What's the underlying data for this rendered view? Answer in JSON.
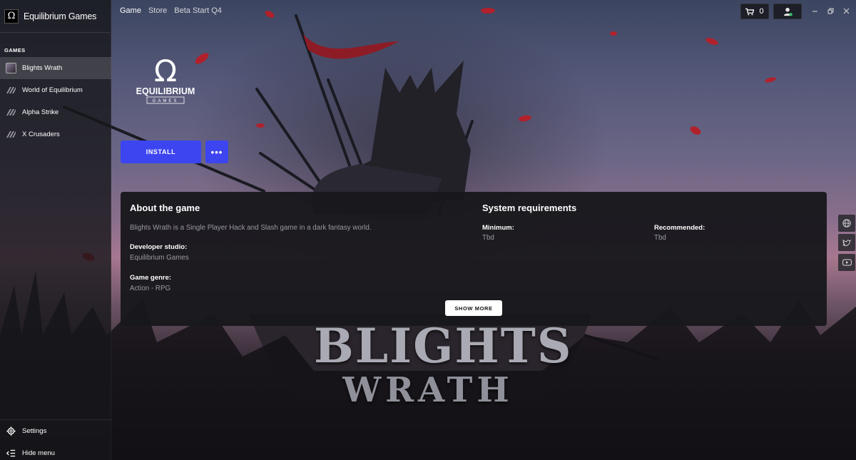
{
  "app": {
    "title": "Equilibrium Games",
    "logo_glyph": "Ω"
  },
  "sidebar": {
    "section_label": "GAMES",
    "items": [
      {
        "label": "Blights Wrath",
        "active": true,
        "icon": "game-cover-thumbnail"
      },
      {
        "label": "World of Equilibrium",
        "active": false,
        "icon": "striped-logo-icon"
      },
      {
        "label": "Alpha Strike",
        "active": false,
        "icon": "striped-logo-icon"
      },
      {
        "label": "X Crusaders",
        "active": false,
        "icon": "striped-logo-icon"
      }
    ],
    "footer": {
      "settings_label": "Settings",
      "settings_icon": "gear-icon",
      "hide_menu_label": "Hide menu",
      "hide_menu_icon": "collapse-menu-icon"
    }
  },
  "topnav": {
    "tabs": [
      {
        "label": "Game",
        "active": true
      },
      {
        "label": "Store",
        "active": false
      },
      {
        "label": "Beta Start Q4",
        "active": false
      }
    ],
    "cart_count": "0",
    "cart_icon": "cart-icon",
    "profile_icon": "user-icon"
  },
  "window_controls": [
    "minimize",
    "restore",
    "close"
  ],
  "hero": {
    "studio_logo_word": "EQUILIBRIUM",
    "studio_logo_sub": "GAMES",
    "studio_logo_glyph": "Ω",
    "install_label": "INSTALL",
    "more_label": "•••"
  },
  "about": {
    "heading": "About the game",
    "description": "Blights Wrath is a Single Player Hack and Slash game in a dark fantasy world.",
    "developer_label": "Developer studio:",
    "developer_value": "Equilibrium Games",
    "genre_label": "Game genre:",
    "genre_value": "Action - RPG"
  },
  "requirements": {
    "heading": "System requirements",
    "minimum_label": "Minimum:",
    "minimum_value": "Tbd",
    "recommended_label": "Recommended:",
    "recommended_value": "Tbd"
  },
  "show_more_label": "SHOW MORE",
  "social_links": [
    "globe-icon",
    "twitter-icon",
    "youtube-icon"
  ],
  "game_title_art": {
    "line1": "BLIGHTS",
    "line2": "WRATH"
  },
  "colors": {
    "accent": "#3d45f0",
    "panel_bg": "#18181c",
    "muted_text": "#9a9aa2"
  }
}
